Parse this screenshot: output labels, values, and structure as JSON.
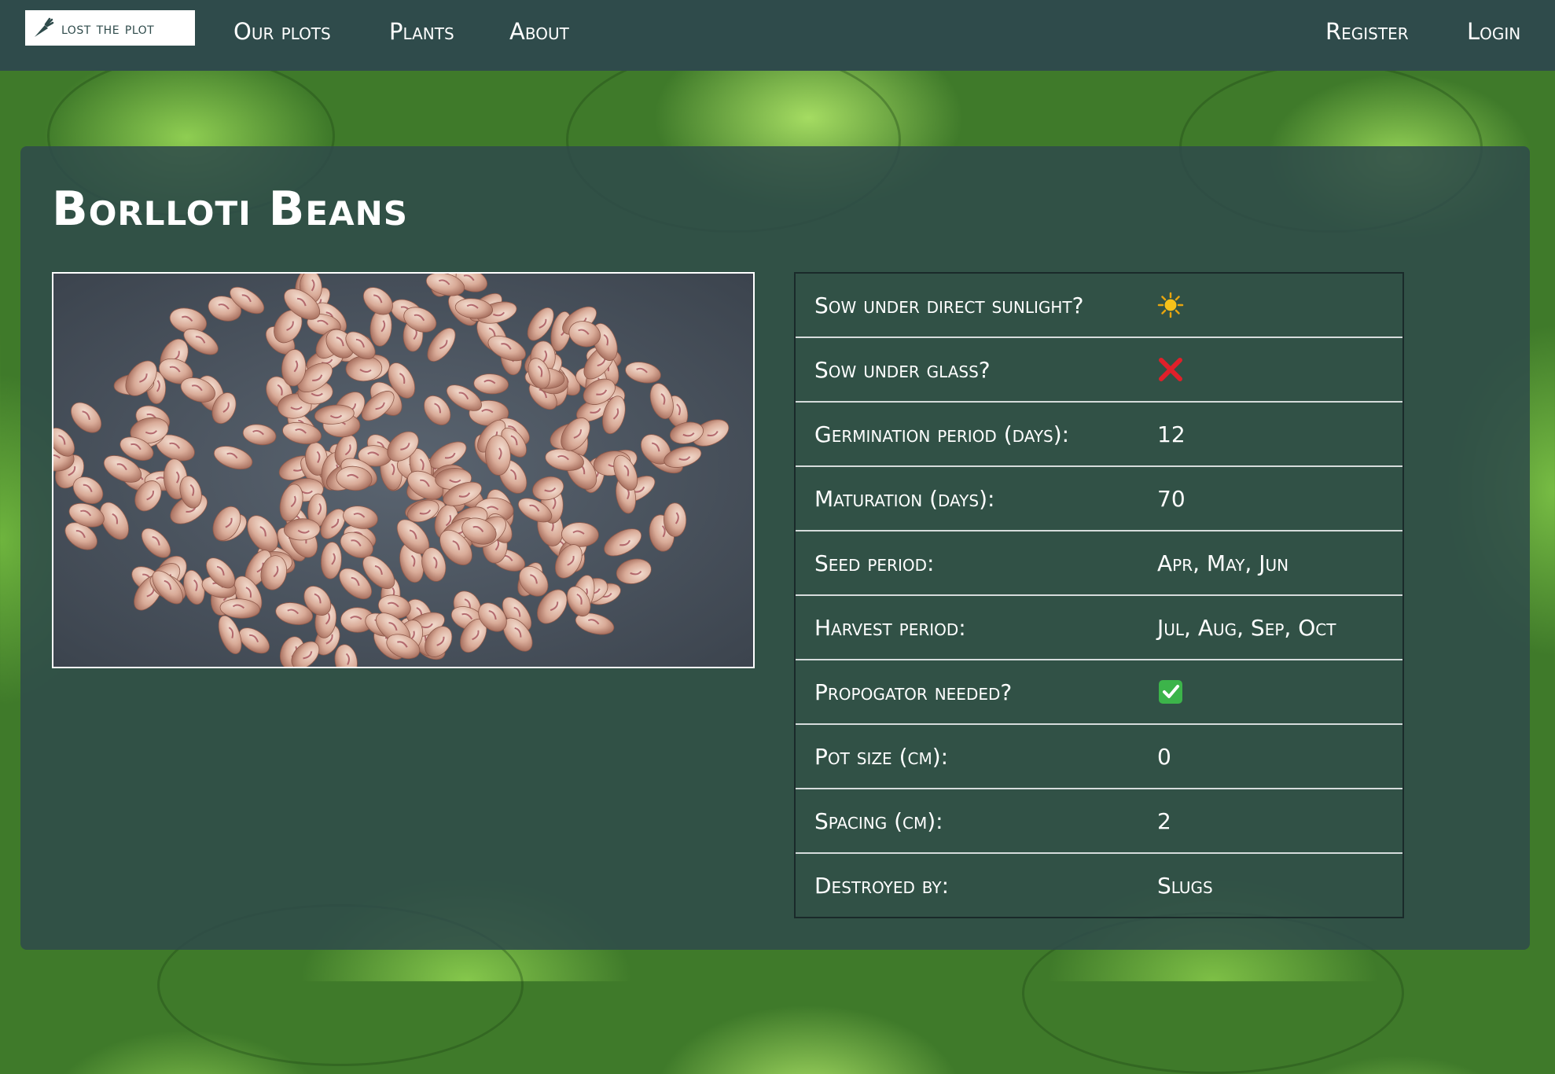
{
  "navbar": {
    "brand_label": "lost the plot",
    "brand_icon": "carrot-icon",
    "links": [
      "Our plots",
      "Plants",
      "About"
    ],
    "register_label": "Register",
    "login_label": "Login",
    "color": "#2f4b4b"
  },
  "page": {
    "title": "Borlloti Beans",
    "photo_icon": "beans-photo"
  },
  "details": [
    {
      "label": "Sow under direct sunlight?",
      "value": "",
      "icon": "sun-icon"
    },
    {
      "label": "Sow under glass?",
      "value": "",
      "icon": "cross-icon"
    },
    {
      "label": "Germination period (days):",
      "value": "12"
    },
    {
      "label": "Maturation (days):",
      "value": "70"
    },
    {
      "label": "Seed period:",
      "value": "Apr, May, Jun"
    },
    {
      "label": "Harvest period:",
      "value": "Jul, Aug, Sep, Oct"
    },
    {
      "label": "Propogator needed?",
      "value": "",
      "icon": "checkmark-icon"
    },
    {
      "label": "Pot size (cm):",
      "value": "0"
    },
    {
      "label": "Spacing (cm):",
      "value": "2"
    },
    {
      "label": "Destroyed by:",
      "value": "Slugs"
    }
  ],
  "colors": {
    "card": "#2f4b4b",
    "cross": "#e0202a",
    "check": "#3cb44a",
    "sun": "#f6c11a"
  }
}
